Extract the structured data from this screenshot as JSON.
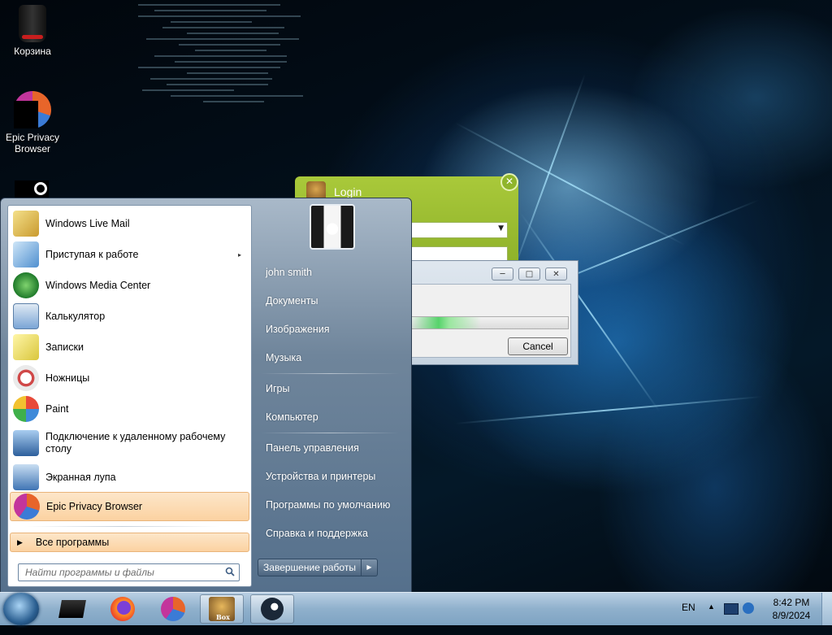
{
  "desktop": {
    "icons": [
      {
        "label": "Корзина",
        "icon": "recycle-bin-icon"
      },
      {
        "label": "Epic Privacy Browser",
        "icon": "epic-browser-icon"
      },
      {
        "label": "",
        "icon": "steam-icon"
      }
    ]
  },
  "login_window": {
    "title": "Login",
    "close_glyph": "✕"
  },
  "progress_dialog": {
    "minimize_glyph": "─",
    "maximize_glyph": "□",
    "close_glyph": "✕",
    "cancel_label": "Cancel",
    "progress_fraction": 0.45
  },
  "start_menu": {
    "programs": [
      {
        "label": "Windows Live Mail",
        "icon": "mail-icon",
        "color": "#e9c84a"
      },
      {
        "label": "Приступая к работе",
        "icon": "getting-started-icon",
        "color": "#7db4e0",
        "submenu": "▸"
      },
      {
        "label": "Windows Media Center",
        "icon": "media-center-icon",
        "color": "#2f9e3a"
      },
      {
        "label": "Калькулятор",
        "icon": "calculator-icon",
        "color": "#7aa5d6"
      },
      {
        "label": "Записки",
        "icon": "sticky-notes-icon",
        "color": "#f2e66a"
      },
      {
        "label": "Ножницы",
        "icon": "snipping-tool-icon",
        "color": "#d04848"
      },
      {
        "label": "Paint",
        "icon": "paint-icon",
        "color": "#e2a44a"
      },
      {
        "label": "Подключение к удаленному рабочему столу",
        "icon": "remote-desktop-icon",
        "color": "#4c7fbf"
      },
      {
        "label": "Экранная лупа",
        "icon": "magnifier-icon",
        "color": "#4f8bc9"
      },
      {
        "label": "Epic Privacy Browser",
        "icon": "epic-browser-icon",
        "color": "#d9532e"
      }
    ],
    "all_programs": "Все программы",
    "search_placeholder": "Найти программы и файлы",
    "places": [
      "john smith",
      "Документы",
      "Изображения",
      "Музыка",
      "Игры",
      "Компьютер",
      "Панель управления",
      "Устройства и принтеры",
      "Программы по умолчанию",
      "Справка и поддержка"
    ],
    "shutdown_label": "Завершение работы",
    "shutdown_arrow": "▶"
  },
  "taskbar": {
    "pinned": [
      {
        "name": "black-box-app-icon"
      },
      {
        "name": "firefox-icon"
      },
      {
        "name": "epic-browser-icon"
      },
      {
        "name": "box-game-icon",
        "text": "Box"
      },
      {
        "name": "steam-icon"
      }
    ],
    "language": "EN",
    "tray_arrow": "▲",
    "time": "8:42 PM",
    "date": "8/9/2024"
  },
  "colors": {
    "menu_highlight": "#fbd2a1",
    "login_green": "#a9c93a",
    "progress_green": "#57d36b"
  }
}
